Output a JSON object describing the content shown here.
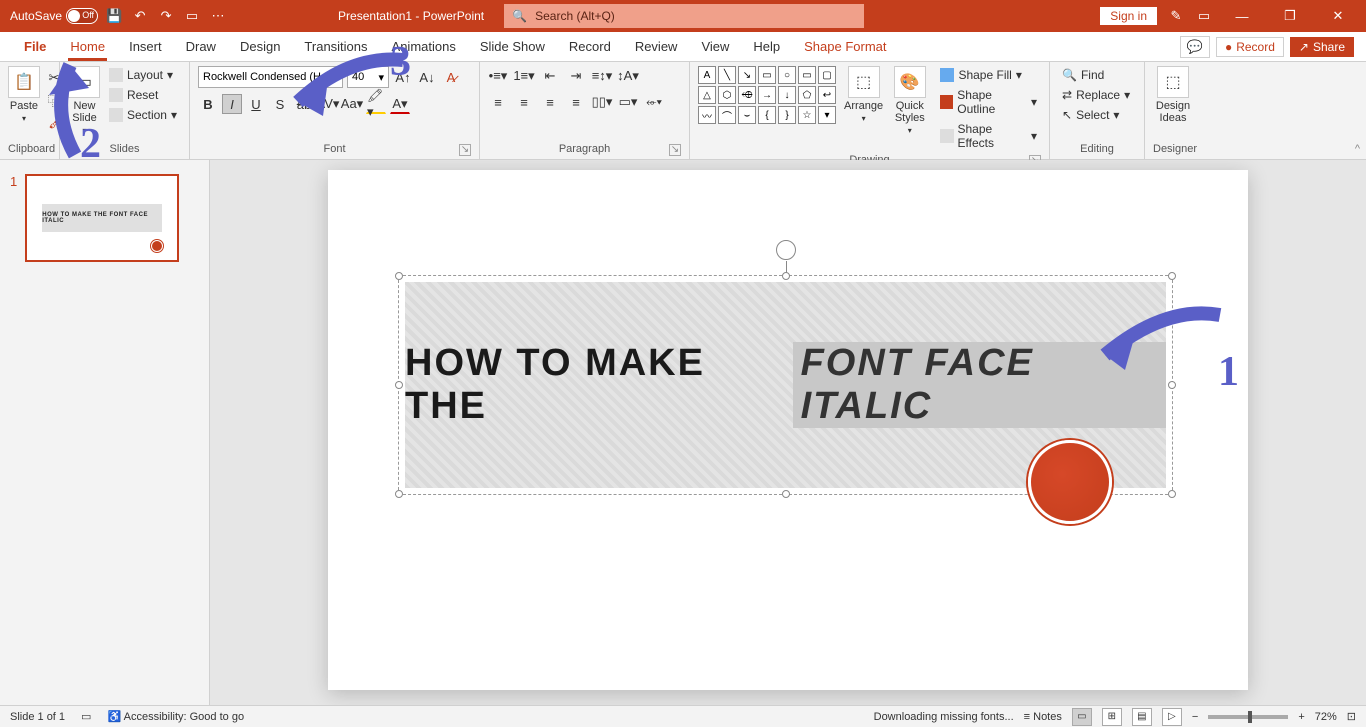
{
  "titlebar": {
    "autosave_label": "AutoSave",
    "autosave_state": "Off",
    "doc_title": "Presentation1  -  PowerPoint",
    "search_placeholder": "Search (Alt+Q)",
    "signin": "Sign in"
  },
  "tabs": {
    "file": "File",
    "home": "Home",
    "insert": "Insert",
    "draw": "Draw",
    "design": "Design",
    "transitions": "Transitions",
    "animations": "Animations",
    "slideshow": "Slide Show",
    "record_tab": "Record",
    "review": "Review",
    "view": "View",
    "help": "Help",
    "shape_format": "Shape Format",
    "record_btn": "Record",
    "share": "Share"
  },
  "ribbon": {
    "clipboard": {
      "paste": "Paste",
      "label": "Clipboard"
    },
    "slides": {
      "new_slide": "New Slide",
      "layout": "Layout",
      "reset": "Reset",
      "section": "Section",
      "label": "Slides"
    },
    "font": {
      "name": "Rockwell Condensed (He",
      "size": "40",
      "label": "Font"
    },
    "paragraph": {
      "label": "Paragraph"
    },
    "drawing": {
      "arrange": "Arrange",
      "quick_styles": "Quick Styles",
      "shape_fill": "Shape Fill",
      "shape_outline": "Shape Outline",
      "shape_effects": "Shape Effects",
      "label": "Drawing"
    },
    "editing": {
      "find": "Find",
      "replace": "Replace",
      "select": "Select",
      "label": "Editing"
    },
    "designer": {
      "design_ideas": "Design Ideas",
      "label": "Designer"
    }
  },
  "thumbs": {
    "num": "1",
    "text": "HOW TO MAKE THE FONT FACE ITALIC"
  },
  "slide": {
    "text_plain": "HOW TO MAKE THE",
    "text_italic": "FONT FACE ITALIC"
  },
  "annotations": {
    "n1": "1",
    "n2": "2",
    "n3": "3"
  },
  "status": {
    "slide_info": "Slide 1 of 1",
    "accessibility": "Accessibility: Good to go",
    "downloading": "Downloading missing fonts...",
    "notes": "Notes",
    "zoom": "72%"
  }
}
